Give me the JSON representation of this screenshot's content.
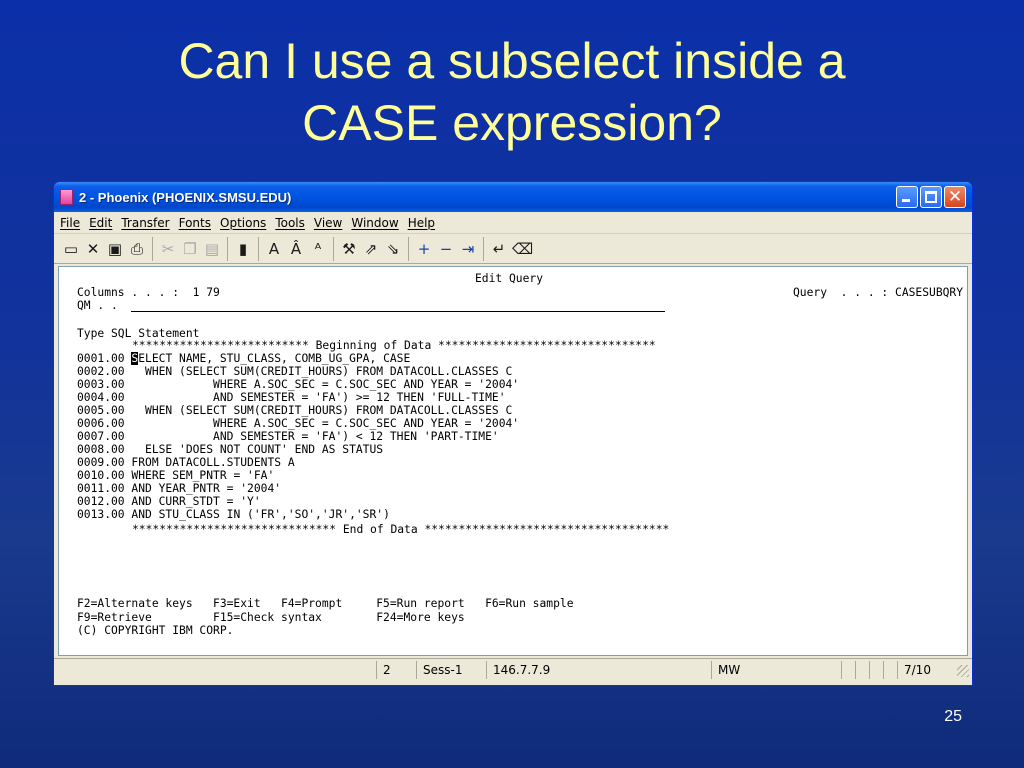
{
  "slide": {
    "title_line1": "Can I use a subselect inside a",
    "title_line2": "CASE expression?",
    "page_number": "25"
  },
  "window": {
    "title": "2 - Phoenix (PHOENIX.SMSU.EDU)",
    "menu": [
      "File",
      "Edit",
      "Transfer",
      "Fonts",
      "Options",
      "Tools",
      "View",
      "Window",
      "Help"
    ]
  },
  "toolbar": {
    "groups": [
      [
        {
          "icon": "monitor-icon",
          "glyph": "▭"
        },
        {
          "icon": "disconnect-icon",
          "glyph": "✕"
        },
        {
          "icon": "save-icon",
          "glyph": "▣"
        },
        {
          "icon": "print-icon",
          "glyph": "⎙"
        }
      ],
      [
        {
          "icon": "cut-icon",
          "glyph": "✂",
          "disabled": true
        },
        {
          "icon": "copy-icon",
          "glyph": "❐",
          "disabled": true
        },
        {
          "icon": "paste-icon",
          "glyph": "▤",
          "disabled": true
        }
      ],
      [
        {
          "icon": "document-icon",
          "glyph": "▮"
        }
      ],
      [
        {
          "icon": "font-icon",
          "glyph": "A"
        },
        {
          "icon": "font-larger-icon",
          "glyph": "Â"
        },
        {
          "icon": "font-smaller-icon",
          "glyph": "ᴬ"
        }
      ],
      [
        {
          "icon": "tools-icon",
          "glyph": "⚒"
        },
        {
          "icon": "send-icon",
          "glyph": "⇗"
        },
        {
          "icon": "receive-icon",
          "glyph": "⇘"
        }
      ],
      [
        {
          "icon": "plus-icon",
          "glyph": "+",
          "blue": true
        },
        {
          "icon": "minus-icon",
          "glyph": "−",
          "blue": true
        },
        {
          "icon": "tab-icon",
          "glyph": "⇥",
          "blue": true
        }
      ],
      [
        {
          "icon": "enter-icon",
          "glyph": "↵"
        },
        {
          "icon": "eraser-icon",
          "glyph": "⌫"
        }
      ]
    ]
  },
  "terminal": {
    "header": "Edit Query",
    "columns_label": "Columns . . . :  1 79",
    "query_label": "Query  . . . : CASESUBQRY",
    "qm_label": "QM . .",
    "type_label": "Type SQL Statement",
    "begin_marker": "************************** Beginning of Data ********************************",
    "lines": [
      {
        "num": "0001.00",
        "text": "ELECT NAME, STU_CLASS, COMB_UG_GPA, CASE",
        "cursor": "S"
      },
      {
        "num": "0002.00",
        "text": "  WHEN (SELECT SUM(CREDIT_HOURS) FROM DATACOLL.CLASSES C"
      },
      {
        "num": "0003.00",
        "text": "            WHERE A.SOC_SEC = C.SOC_SEC AND YEAR = '2004'"
      },
      {
        "num": "0004.00",
        "text": "            AND SEMESTER = 'FA') >= 12 THEN 'FULL-TIME'"
      },
      {
        "num": "0005.00",
        "text": "  WHEN (SELECT SUM(CREDIT_HOURS) FROM DATACOLL.CLASSES C"
      },
      {
        "num": "0006.00",
        "text": "            WHERE A.SOC_SEC = C.SOC_SEC AND YEAR = '2004'"
      },
      {
        "num": "0007.00",
        "text": "            AND SEMESTER = 'FA') < 12 THEN 'PART-TIME'"
      },
      {
        "num": "0008.00",
        "text": "  ELSE 'DOES NOT COUNT' END AS STATUS"
      },
      {
        "num": "0009.00",
        "text": "FROM DATACOLL.STUDENTS A"
      },
      {
        "num": "0010.00",
        "text": "WHERE SEM_PNTR = 'FA'"
      },
      {
        "num": "0011.00",
        "text": "AND YEAR_PNTR = '2004'"
      },
      {
        "num": "0012.00",
        "text": "AND CURR_STDT = 'Y'"
      },
      {
        "num": "0013.00",
        "text": "AND STU_CLASS IN ('FR','SO','JR','SR')"
      }
    ],
    "end_marker": "****************************** End of Data ************************************",
    "fkeys_line1": "F2=Alternate keys   F3=Exit   F4=Prompt     F5=Run report   F6=Run sample",
    "fkeys_line2": "F9=Retrieve         F15=Check syntax        F24=More keys",
    "copyright": "(C) COPYRIGHT IBM CORP."
  },
  "statusbar": {
    "session_num": "2",
    "session": "Sess-1",
    "ip": "146.7.7.9",
    "mode": "MW",
    "position": "7/10"
  }
}
